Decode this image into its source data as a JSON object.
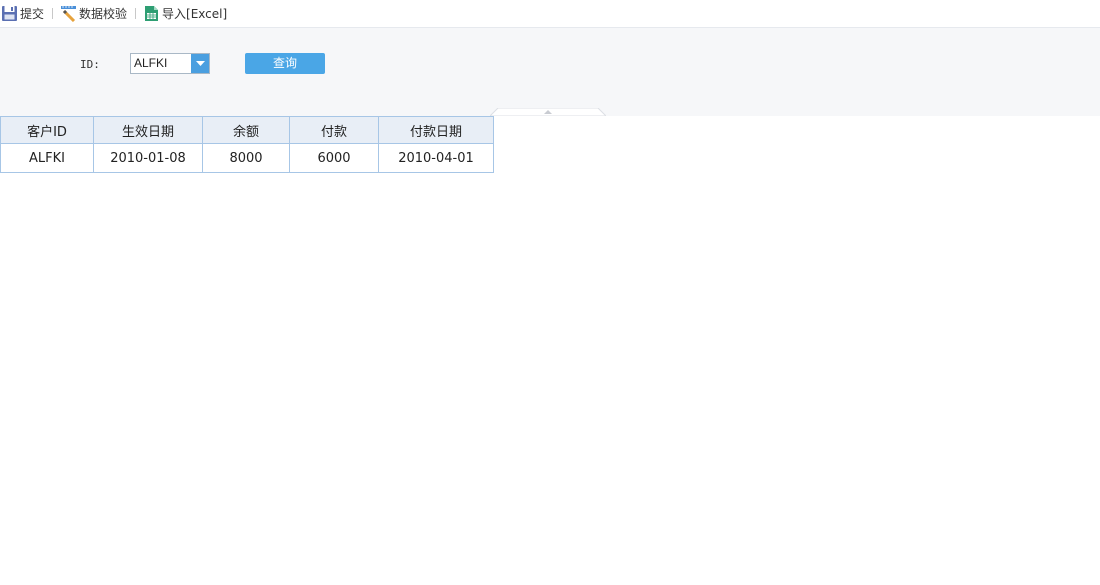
{
  "toolbar": {
    "submit_label": "提交",
    "validate_label": "数据校验",
    "import_label": "导入[Excel]",
    "icons": {
      "submit": "save-icon",
      "validate": "ruler-pencil-icon",
      "import": "excel-file-icon"
    }
  },
  "params": {
    "id_label": "ID:",
    "id_value": "ALFKI",
    "query_label": "查询"
  },
  "table": {
    "headers": [
      "客户ID",
      "生效日期",
      "余额",
      "付款",
      "付款日期"
    ],
    "rows": [
      [
        "ALFKI",
        "2010-01-08",
        "8000",
        "6000",
        "2010-04-01"
      ]
    ]
  },
  "colors": {
    "accent": "#4aa6e6",
    "dropdown_arrow_bg": "#4a9fe0",
    "table_border": "#a7c6e6",
    "header_bg": "#e8eef6",
    "panel_bg": "#f6f7f9"
  }
}
